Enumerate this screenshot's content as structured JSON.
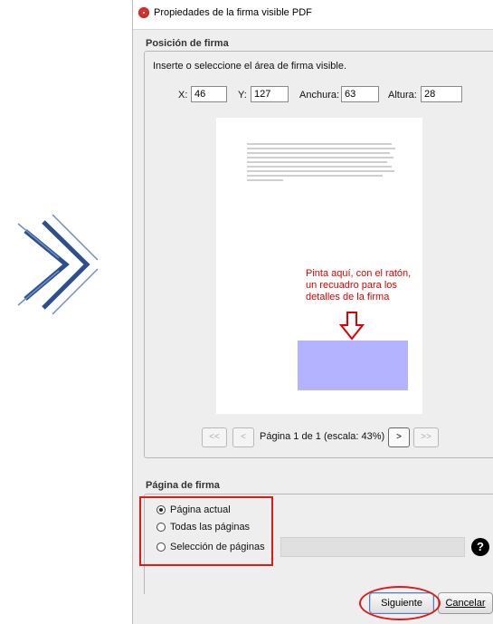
{
  "window": {
    "title": "Propiedades de la firma visible PDF"
  },
  "position_section": {
    "label": "Posición de firma",
    "instruction": "Inserte o seleccione el área de firma visible.",
    "x_label": "X:",
    "x_value": "46",
    "y_label": "Y:",
    "y_value": "127",
    "width_label": "Anchura:",
    "width_value": "63",
    "height_label": "Altura:",
    "height_value": "28"
  },
  "preview": {
    "annotation": "Pinta aquí, con el ratón, un recuadro para los detalles de la firma",
    "signature_box_color": "#b3b3ff",
    "annotation_color": "#e00000"
  },
  "navigation": {
    "first": "<<",
    "prev": "<",
    "page_info": "Página 1 de 1 (escala: 43%)",
    "next": ">",
    "last": ">>"
  },
  "page_section": {
    "label": "Página de firma",
    "options": [
      {
        "label": "Página actual",
        "selected": true
      },
      {
        "label": "Todas las páginas",
        "selected": false
      },
      {
        "label": "Selección de páginas",
        "selected": false
      }
    ],
    "help": "?"
  },
  "buttons": {
    "next": "Siguiente",
    "cancel": "Cancelar"
  }
}
